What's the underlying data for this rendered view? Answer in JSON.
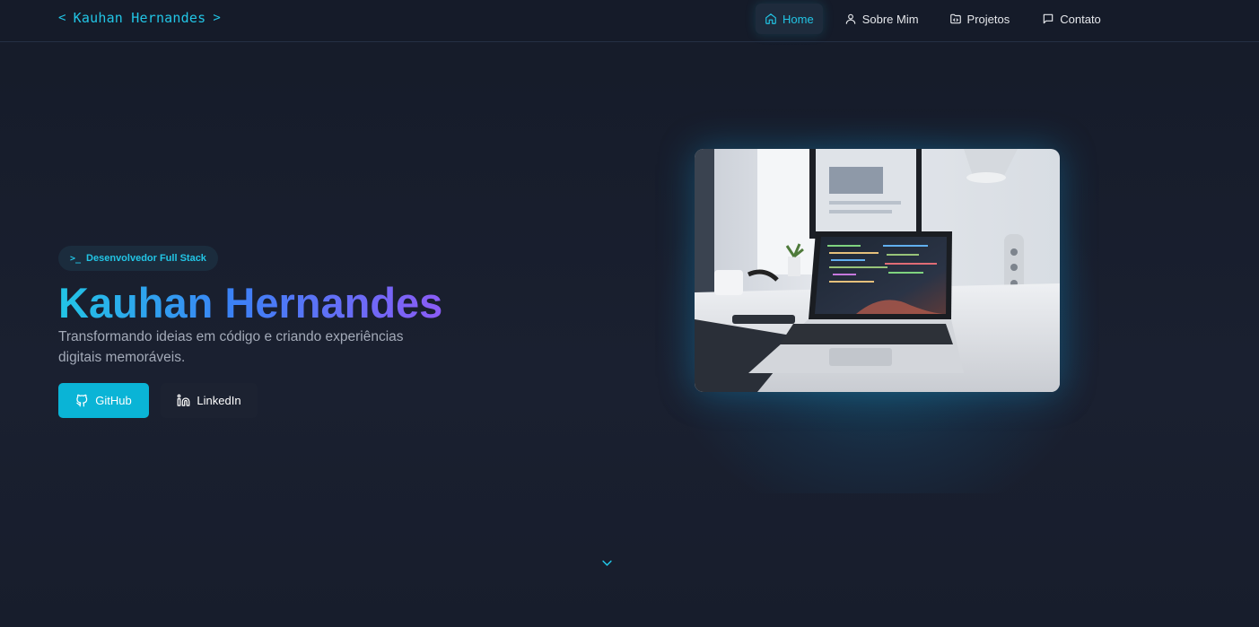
{
  "header": {
    "brand": "Kauhan Hernandes",
    "nav": [
      {
        "label": "Home",
        "icon": "home-icon",
        "active": true
      },
      {
        "label": "Sobre Mim",
        "icon": "user-icon"
      },
      {
        "label": "Projetos",
        "icon": "folder-code-icon"
      },
      {
        "label": "Contato",
        "icon": "message-icon"
      }
    ]
  },
  "hero": {
    "badge": "Desenvolvedor Full Stack",
    "badge_prefix": ">_",
    "title": "Kauhan Hernandes",
    "subtitle": "Transformando ideias em código e criando experiências digitais memoráveis.",
    "buttons": {
      "github": "GitHub",
      "linkedin": "LinkedIn"
    }
  },
  "colors": {
    "accent": "#22c5e5",
    "background": "#171d2c",
    "gradient_start": "#22c5e5",
    "gradient_mid": "#3b82f6",
    "gradient_end": "#8b5cf6"
  }
}
